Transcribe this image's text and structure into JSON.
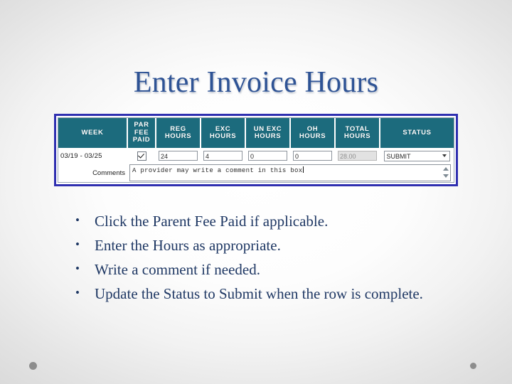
{
  "slide": {
    "title": "Enter Invoice Hours",
    "title_color": "#2e5395",
    "body_color": "#1f3864"
  },
  "screenshot": {
    "border_color": "#2f2fb0",
    "header_bg": "#1c6b7d",
    "comments_bg": "#96cbcb",
    "columns": [
      "WEEK",
      "PAR FEE PAID",
      "REG HOURS",
      "EXC HOURS",
      "UN EXC HOURS",
      "OH HOURS",
      "TOTAL HOURS",
      "STATUS"
    ],
    "headers": {
      "week": "WEEK",
      "par_fee_paid_line1": "PAR",
      "par_fee_paid_line2": "FEE",
      "par_fee_paid_line3": "PAID",
      "reg_line1": "REG",
      "reg_line2": "HOURS",
      "exc_line1": "EXC",
      "exc_line2": "HOURS",
      "unexc_line1": "UN EXC",
      "unexc_line2": "HOURS",
      "oh_line1": "OH",
      "oh_line2": "HOURS",
      "total_line1": "TOTAL",
      "total_line2": "HOURS",
      "status": "STATUS"
    },
    "row": {
      "week": "03/19 - 03/25",
      "par_fee_paid_checked": true,
      "reg_hours": "24",
      "exc_hours": "4",
      "un_exc_hours": "0",
      "oh_hours": "0",
      "total_hours": "28.00",
      "status": "SUBMIT"
    },
    "comments": {
      "label": "Comments",
      "value": "A provider may write a comment in this box",
      "scroll_up_icon": "triangle-up-icon",
      "scroll_down_icon": "triangle-down-icon"
    }
  },
  "bullets": [
    "Click the Parent Fee Paid if applicable.",
    "Enter the Hours as appropriate.",
    "Write a comment if needed.",
    "Update the Status to Submit when the row is complete."
  ]
}
